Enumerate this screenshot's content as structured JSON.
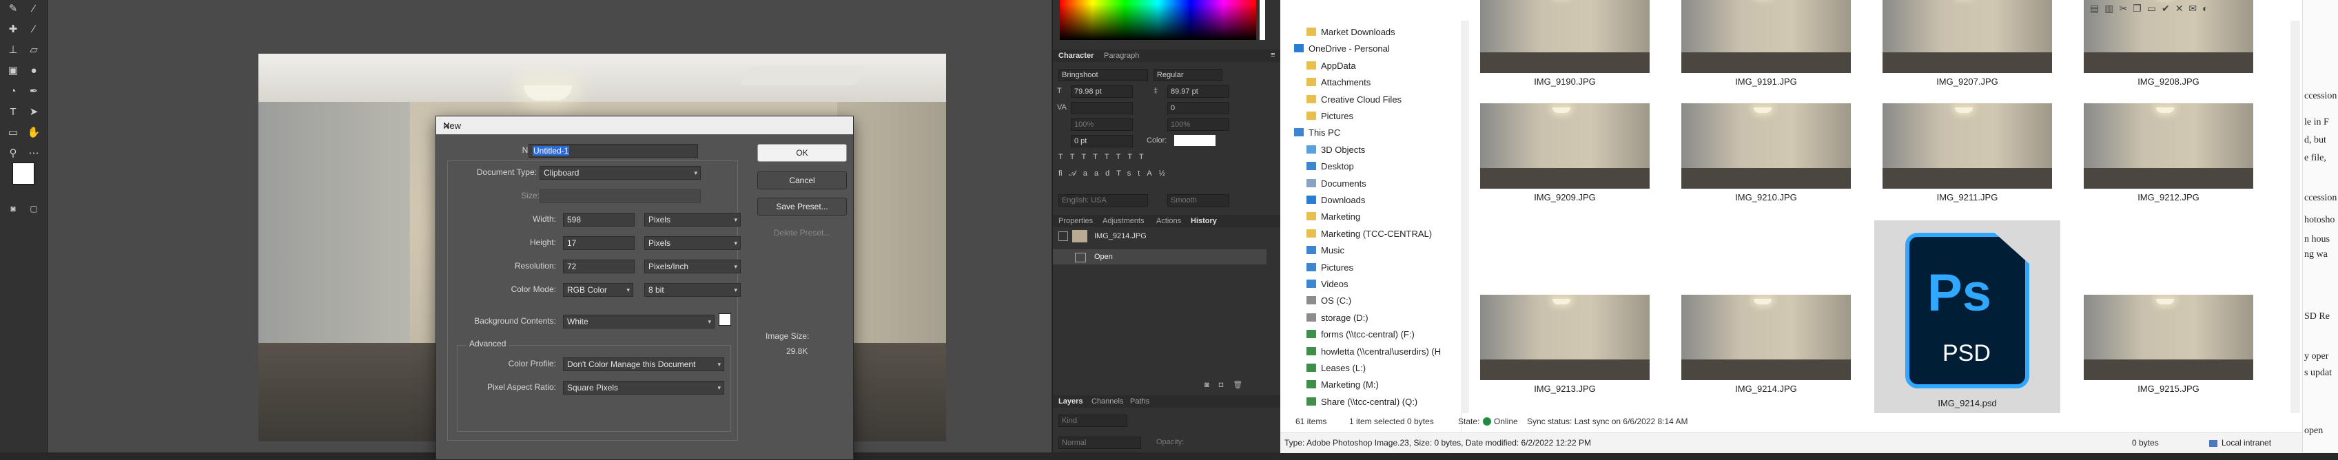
{
  "dialog": {
    "title": "New",
    "name_label": "Name:",
    "name_value": "Untitled-1",
    "doctype_label": "Document Type:",
    "doctype_value": "Clipboard",
    "size_label": "Size:",
    "width_label": "Width:",
    "width_value": "598",
    "width_unit": "Pixels",
    "height_label": "Height:",
    "height_value": "17",
    "height_unit": "Pixels",
    "resolution_label": "Resolution:",
    "resolution_value": "72",
    "resolution_unit": "Pixels/Inch",
    "colormode_label": "Color Mode:",
    "colormode_value": "RGB Color",
    "bitdepth_value": "8 bit",
    "bg_label": "Background Contents:",
    "bg_value": "White",
    "advanced_label": "Advanced",
    "profile_label": "Color Profile:",
    "profile_value": "Don't Color Manage this Document",
    "pixel_aspect_label": "Pixel Aspect Ratio:",
    "pixel_aspect_value": "Square Pixels",
    "ok": "OK",
    "cancel": "Cancel",
    "save_preset": "Save Preset...",
    "delete_preset": "Delete Preset...",
    "image_size_label": "Image Size:",
    "image_size_value": "29.8K"
  },
  "panels": {
    "character_tab": "Character",
    "paragraph_tab": "Paragraph",
    "font_family": "Bringshoot",
    "font_style": "Regular",
    "font_size": "79.98 pt",
    "leading": "89.97 pt",
    "tracking": "0",
    "vscale": "100%",
    "hscale": "100%",
    "baseline": "0 pt",
    "color_label": "Color:",
    "language": "English: USA",
    "antialias": "Smooth",
    "properties_tab": "Properties",
    "adjustments_tab": "Adjustments",
    "actions_tab": "Actions",
    "history_tab": "History",
    "history_snapshot": "IMG_9214.JPG",
    "history_open": "Open",
    "layers_tab": "Layers",
    "channels_tab": "Channels",
    "paths_tab": "Paths",
    "layers_kind": "Kind",
    "layers_blend": "Normal",
    "layers_opacity": "Opacity:"
  },
  "explorer": {
    "nav": [
      {
        "label": "Market Downloads",
        "icon": "folder-icon"
      },
      {
        "label": "OneDrive - Personal",
        "icon": "cloud-icon"
      },
      {
        "label": "AppData",
        "icon": "folder-icon"
      },
      {
        "label": "Attachments",
        "icon": "folder-icon"
      },
      {
        "label": "Creative Cloud Files",
        "icon": "folder-icon"
      },
      {
        "label": "Pictures",
        "icon": "folder-icon"
      },
      {
        "label": "This PC",
        "icon": "computer-icon"
      },
      {
        "label": "3D Objects",
        "icon": "cube-icon"
      },
      {
        "label": "Desktop",
        "icon": "desktop-icon"
      },
      {
        "label": "Documents",
        "icon": "documents-icon"
      },
      {
        "label": "Downloads",
        "icon": "download-icon"
      },
      {
        "label": "Marketing",
        "icon": "folder-icon"
      },
      {
        "label": "Marketing (TCC-CENTRAL)",
        "icon": "folder-icon"
      },
      {
        "label": "Music",
        "icon": "music-icon"
      },
      {
        "label": "Pictures",
        "icon": "pictures-icon"
      },
      {
        "label": "Videos",
        "icon": "video-icon"
      },
      {
        "label": "OS (C:)",
        "icon": "drive-icon"
      },
      {
        "label": "storage (D:)",
        "icon": "drive-icon"
      },
      {
        "label": "forms (\\\\tcc-central) (F:)",
        "icon": "network-drive-icon"
      },
      {
        "label": "howletta (\\\\central\\userdirs) (H",
        "icon": "network-drive-icon"
      },
      {
        "label": "Leases (L:)",
        "icon": "network-drive-icon"
      },
      {
        "label": "Marketing (M:)",
        "icon": "network-drive-icon"
      },
      {
        "label": "Share (\\\\tcc-central) (Q:)",
        "icon": "network-drive-icon"
      }
    ],
    "files": [
      {
        "name": "IMG_9190.JPG"
      },
      {
        "name": "IMG_9191.JPG"
      },
      {
        "name": "IMG_9207.JPG"
      },
      {
        "name": "IMG_9208.JPG"
      },
      {
        "name": "IMG_9209.JPG"
      },
      {
        "name": "IMG_9210.JPG"
      },
      {
        "name": "IMG_9211.JPG"
      },
      {
        "name": "IMG_9212.JPG"
      },
      {
        "name": "IMG_9213.JPG"
      },
      {
        "name": "IMG_9214.JPG"
      },
      {
        "name": "IMG_9214.psd"
      },
      {
        "name": "IMG_9215.JPG"
      }
    ],
    "status": {
      "items": "61 items",
      "selected": "1 item selected  0 bytes",
      "state": "State:",
      "online": "Online",
      "sync": "Sync status:  Last sync on 6/6/2022 8:14 AM"
    },
    "details": {
      "type": "Type: Adobe Photoshop Image.23, Size: 0 bytes, Date modified: 6/2/2022 12:22 PM",
      "size": "0 bytes",
      "zone": "Local intranet"
    },
    "psd_badge": "Ps",
    "psd_label": "PSD"
  },
  "rightstrip": {
    "lines": [
      "ccession",
      "le in F",
      "d, but",
      "e file,",
      "ccession",
      "hotosho",
      "n hous",
      "ng wa",
      "SD Re",
      "y oper",
      "s updat",
      "open"
    ]
  },
  "colors": {
    "ps_blue": "#31a8ff",
    "ps_dark": "#001e36",
    "ok_green": "#1e8e3e",
    "select_blue": "#2e6bd6"
  }
}
